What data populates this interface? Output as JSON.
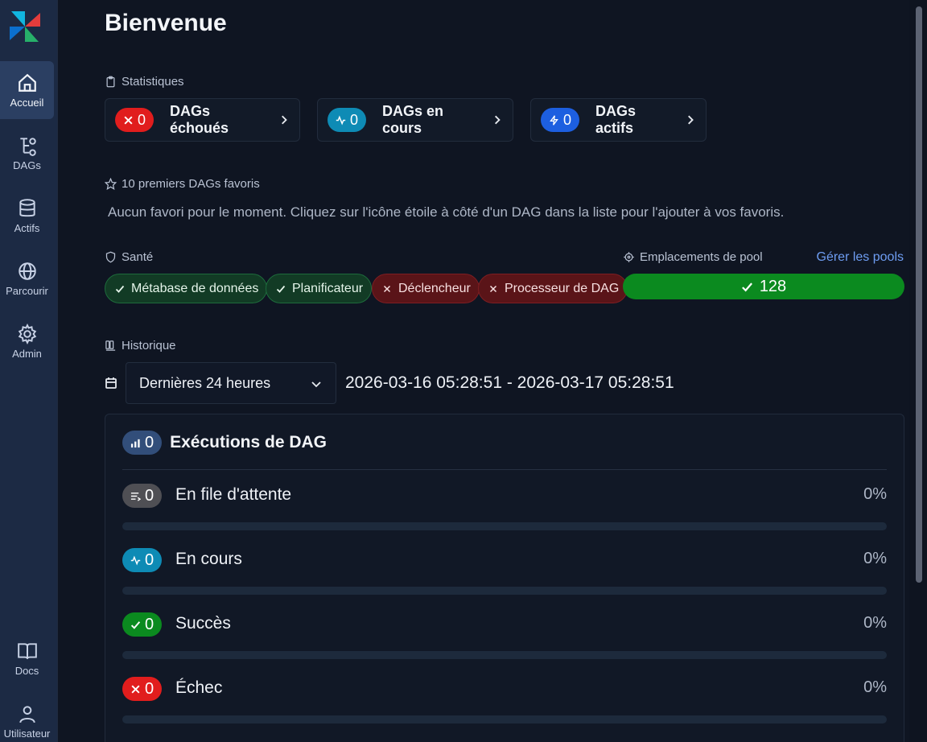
{
  "nav": {
    "items": [
      {
        "label": "Accueil",
        "icon": "home-icon"
      },
      {
        "label": "DAGs",
        "icon": "dag-icon"
      },
      {
        "label": "Actifs",
        "icon": "database-icon"
      },
      {
        "label": "Parcourir",
        "icon": "globe-icon"
      },
      {
        "label": "Admin",
        "icon": "gear-icon"
      },
      {
        "label": "Docs",
        "icon": "book-icon"
      },
      {
        "label": "Utilisateur",
        "icon": "user-icon"
      }
    ],
    "active": "Accueil"
  },
  "page": {
    "title": "Bienvenue"
  },
  "stats": {
    "heading": "Statistiques",
    "cards": [
      {
        "count": "0",
        "label": "DAGs échoués",
        "color": "#e11d1d",
        "icon": "x-icon"
      },
      {
        "count": "0",
        "label": "DAGs en cours",
        "color": "#0e8bb5",
        "icon": "activity-icon"
      },
      {
        "count": "0",
        "label": "DAGs actifs",
        "color": "#1d5fe0",
        "icon": "bolt-icon"
      }
    ]
  },
  "favorites": {
    "heading": "10 premiers DAGs favoris",
    "empty": "Aucun favori pour le moment. Cliquez sur l'icône étoile à côté d'un DAG dans la liste pour l'ajouter à vos favoris."
  },
  "health": {
    "heading": "Santé",
    "items": [
      {
        "label": "Métabase de données",
        "status": "ok"
      },
      {
        "label": "Planificateur",
        "status": "ok"
      },
      {
        "label": "Déclencheur",
        "status": "bad"
      },
      {
        "label": "Processeur de DAG",
        "status": "bad"
      }
    ]
  },
  "pool": {
    "heading": "Emplacements de pool",
    "manage": "Gérer les pools",
    "value": "128",
    "color": "#0b8a1f"
  },
  "history": {
    "heading": "Historique",
    "range_selected": "Dernières 24 heures",
    "range_text": "2026-03-16 05:28:51 - 2026-03-17 05:28:51"
  },
  "runs": {
    "count": "0",
    "title": "Exécutions de DAG",
    "rows": [
      {
        "label": "En file d'attente",
        "count": "0",
        "pct": "0%",
        "fraction": 0,
        "color": "#4f4f54",
        "icon": "queue-icon"
      },
      {
        "label": "En cours",
        "count": "0",
        "pct": "0%",
        "fraction": 0,
        "color": "#0e8bb5",
        "icon": "activity-icon"
      },
      {
        "label": "Succès",
        "count": "0",
        "pct": "0%",
        "fraction": 0,
        "color": "#0b8a1f",
        "icon": "check-icon"
      },
      {
        "label": "Échec",
        "count": "0",
        "pct": "0%",
        "fraction": 0,
        "color": "#e11d1d",
        "icon": "x-icon"
      }
    ]
  }
}
